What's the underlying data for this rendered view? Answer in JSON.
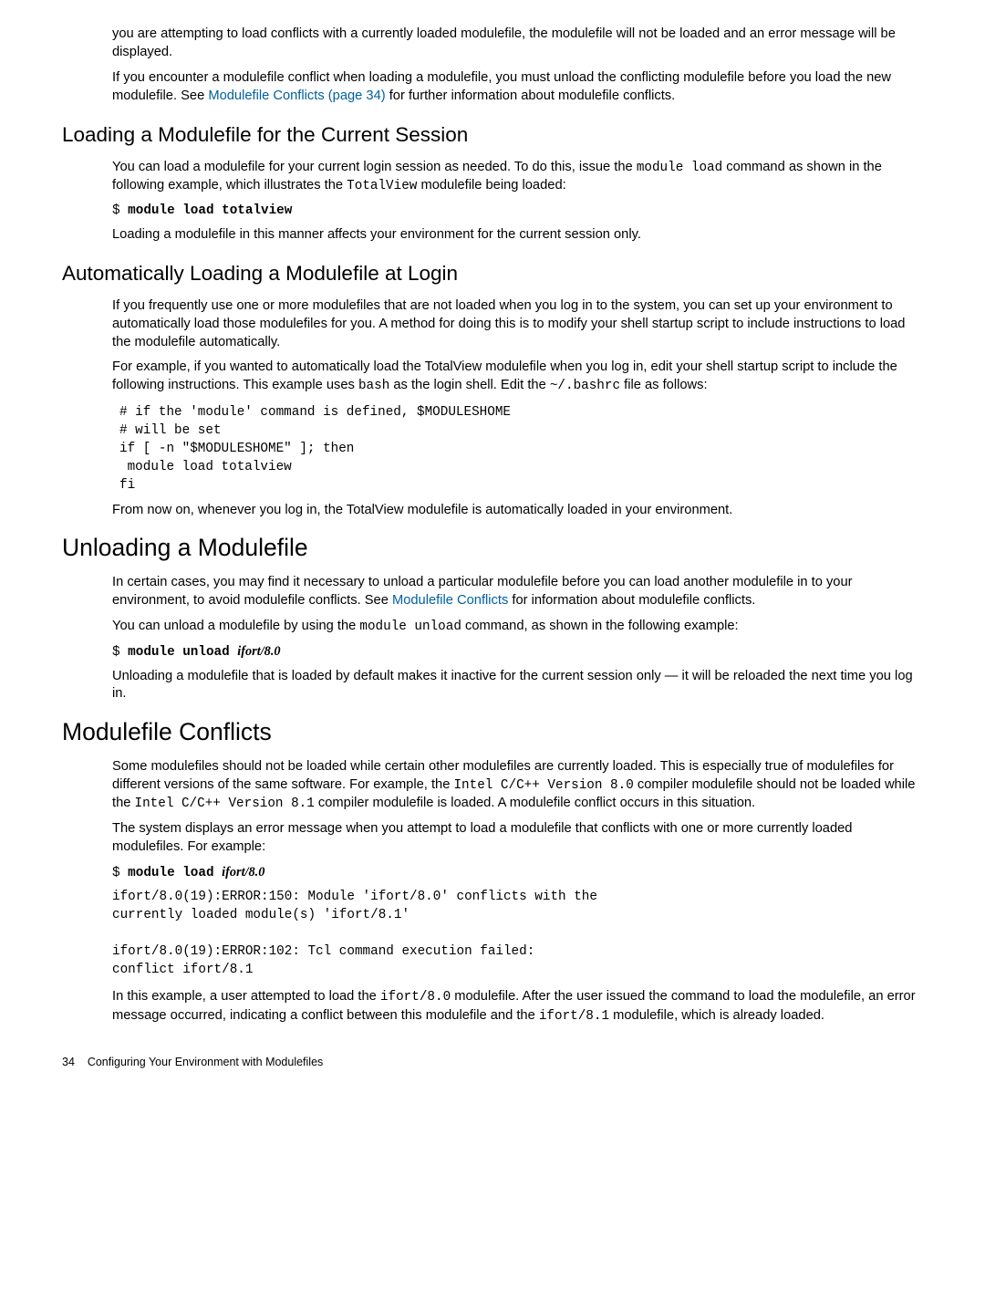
{
  "p1": "you are attempting to load conflicts with a currently loaded modulefile, the modulefile will not be loaded and an error message will be displayed.",
  "p2a": "If you encounter a modulefile conflict when loading a modulefile, you must unload the conflicting modulefile before you load the new modulefile. See ",
  "p2link": "Modulefile Conflicts (page 34)",
  "p2b": " for further information about modulefile conflicts.",
  "h_loading_current": "Loading a Modulefile for the Current Session",
  "p3a": "You can load a modulefile for your current login session as needed. To do this, issue the ",
  "p3code1": "module load",
  "p3b": " command as shown in the following example, which illustrates the ",
  "p3code2": "TotalView",
  "p3c": " modulefile being loaded:",
  "code_tv_prompt": "$ ",
  "code_tv_cmd": "module load totalview",
  "p4": "Loading a modulefile in this manner affects your environment for the current session only.",
  "h_auto": "Automatically Loading a Modulefile at Login",
  "p5": "If you frequently use one or more modulefiles that are not loaded when you log in to the system, you can set up your environment to automatically load those modulefiles for you. A method for doing this is to modify your shell startup script to include instructions to load the modulefile automatically.",
  "p6a": "For example, if you wanted to automatically load the TotalView modulefile when you log in, edit your shell startup script to include the following instructions. This example uses ",
  "p6code1": "bash",
  "p6b": " as the login shell. Edit the ",
  "p6code2": "~/.bashrc",
  "p6c": " file as follows:",
  "codeblock1": "# if the 'module' command is defined, $MODULESHOME\n# will be set\nif [ -n \"$MODULESHOME\" ]; then\n module load totalview\nfi",
  "p7": "From now on, whenever you log in, the TotalView modulefile is automatically loaded in your environment.",
  "h_unload": "Unloading a Modulefile",
  "p8a": "In certain cases, you may find it necessary to unload a particular modulefile before you can load another modulefile in to your environment, to avoid modulefile conflicts. See ",
  "p8link": "Modulefile Conflicts",
  "p8b": " for information about modulefile conflicts.",
  "p9a": "You can unload a modulefile by using the ",
  "p9code": "module unload",
  "p9b": " command, as shown in the following example:",
  "code_unload_prompt": "$ ",
  "code_unload_cmd": "module unload ",
  "code_unload_arg": "ifort/8.0",
  "p10": "Unloading a modulefile that is loaded by default makes it inactive for the current session only — it will be reloaded the next time you log in.",
  "h_conflicts": "Modulefile Conflicts",
  "p11a": "Some modulefiles should not be loaded while certain other modulefiles are currently loaded. This is especially true of modulefiles for different versions of the same software. For example, the ",
  "p11code1": "Intel C/C++ Version 8.0",
  "p11b": " compiler modulefile should not be loaded while the ",
  "p11code2": "Intel C/C++ Version 8.1",
  "p11c": " compiler modulefile is loaded. A modulefile conflict occurs in this situation.",
  "p12": "The system displays an error message when you attempt to load a modulefile that conflicts with one or more currently loaded modulefiles. For example:",
  "code_load_prompt": "$ ",
  "code_load_cmd": "module load ",
  "code_load_arg": "ifort/8.0",
  "codeblock2": "ifort/8.0(19):ERROR:150: Module 'ifort/8.0' conflicts with the\ncurrently loaded module(s) 'ifort/8.1'\n\nifort/8.0(19):ERROR:102: Tcl command execution failed:\nconflict ifort/8.1",
  "p13a": "In this example, a user attempted to load the ",
  "p13code1": "ifort/8.0",
  "p13b": " modulefile. After the user issued the command to load the modulefile, an error message occurred, indicating a conflict between this modulefile and the ",
  "p13code2": "ifort/8.1",
  "p13c": " modulefile, which is already loaded.",
  "footer_page": "34",
  "footer_title": "Configuring Your Environment with Modulefiles"
}
